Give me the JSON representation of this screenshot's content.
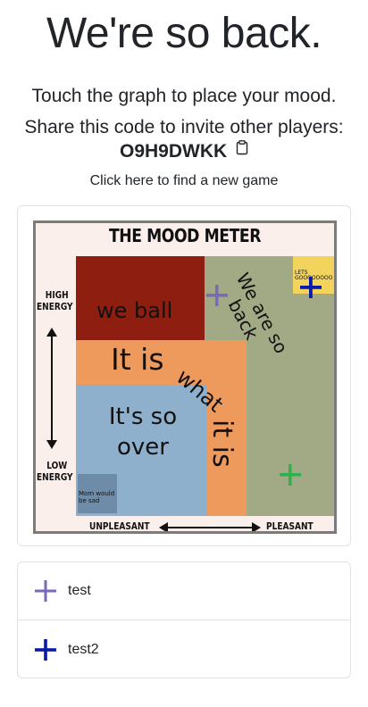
{
  "header": {
    "title": "We're so back.",
    "subtitle": "Touch the graph to place your mood.",
    "share_text": "Share this code to invite other players:",
    "game_code": "O9H9DWKK",
    "find_prefix": "Click",
    "find_link": "here",
    "find_suffix": "to find a new game"
  },
  "meter": {
    "title": "THE MOOD METER",
    "zones": {
      "we_ball": "we ball",
      "it_is": "It is",
      "what": "what",
      "so_over_line1": "It's so",
      "so_over_line2": "over",
      "it_is_vertical": "it is",
      "so_back_line1": "We are so",
      "so_back_line2": "back",
      "lets_go": "LETS GOOOOOOOO",
      "mom": "Mom would be sad"
    },
    "axes": {
      "high_line1": "HIGH",
      "high_line2": "ENERGY",
      "low_line1": "LOW",
      "low_line2": "ENERGY",
      "unpleasant": "UNPLEASANT",
      "pleasant": "PLEASANT"
    },
    "colors": {
      "red_zone": "#8e1f10",
      "green_zone": "#a1a985",
      "yellow_zone": "#f2d35b",
      "orange_zone": "#ef9a5d",
      "blue_zone": "#8fb0cc",
      "border": "#7b7b7b"
    }
  },
  "players": [
    {
      "name": "test",
      "color": "#7a68b8",
      "icon": "plus-icon"
    },
    {
      "name": "test2",
      "color": "#0a1aa8",
      "icon": "plus-icon"
    },
    {
      "name": "",
      "color": "#2bb24c",
      "icon": "plus-icon"
    }
  ]
}
